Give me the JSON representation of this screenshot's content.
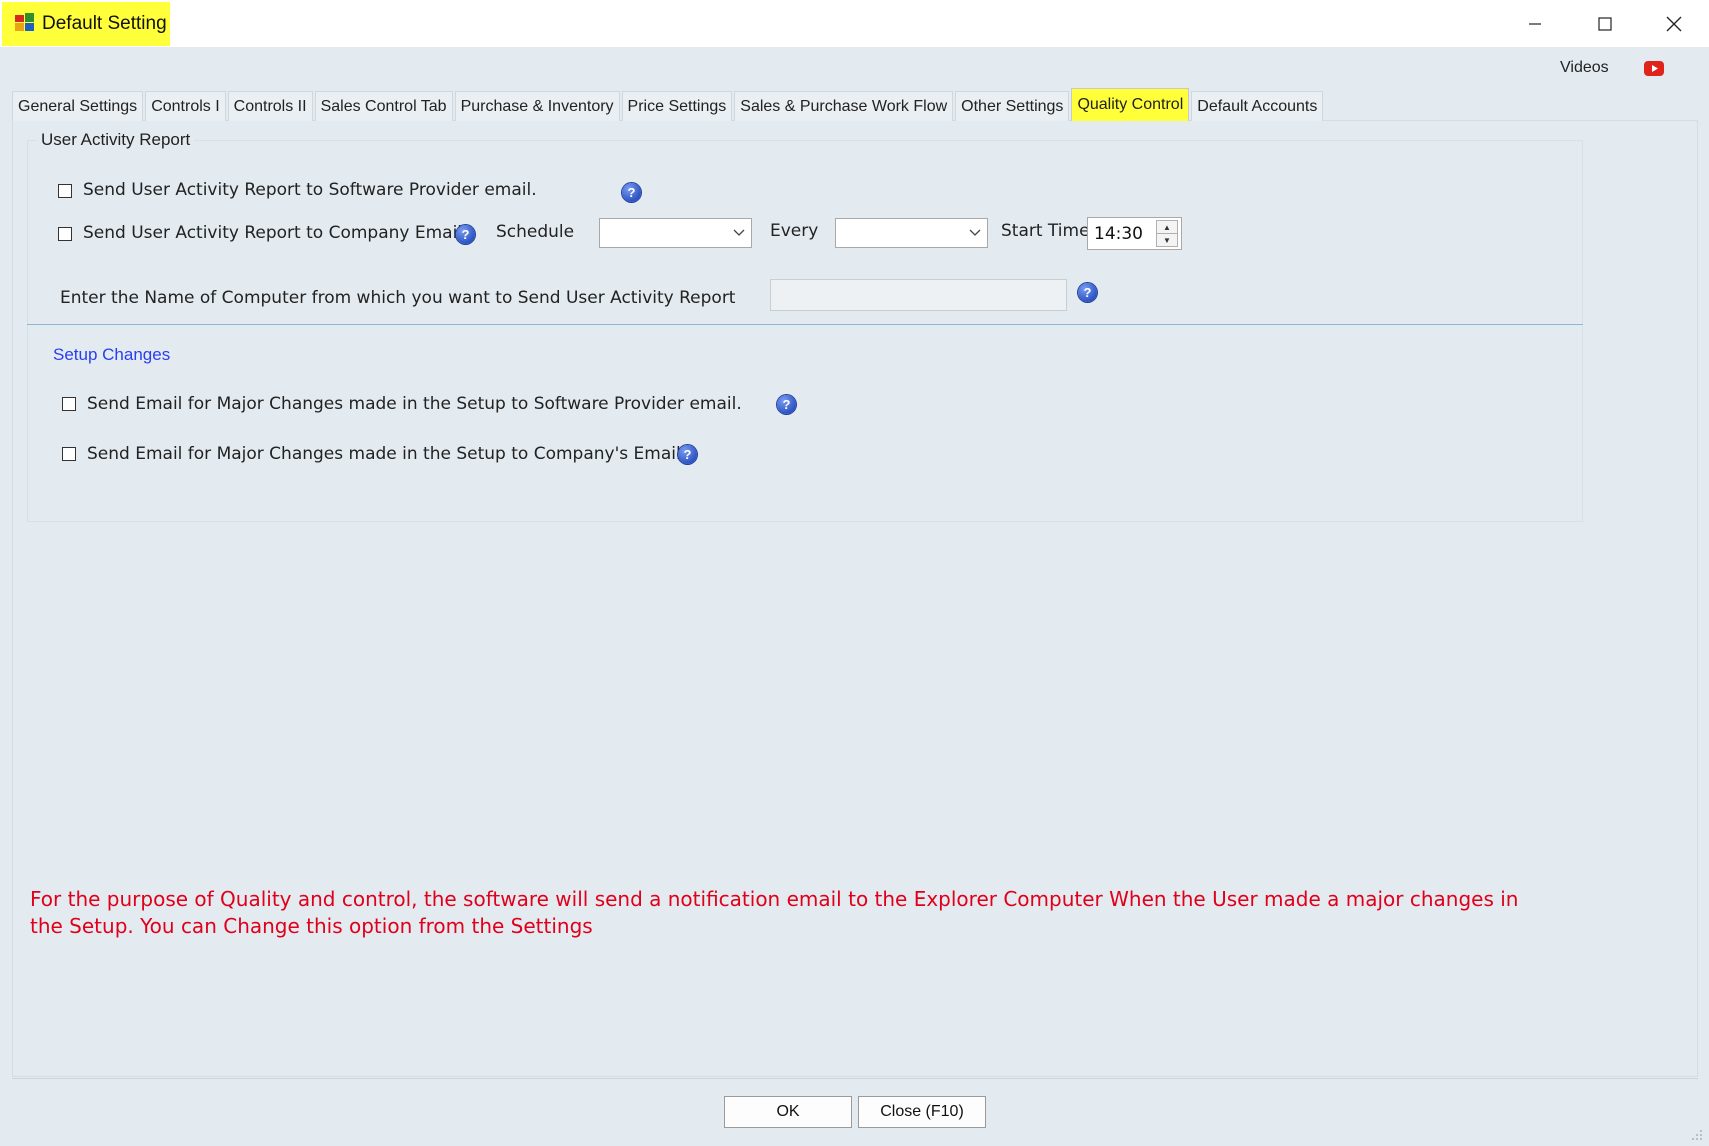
{
  "window": {
    "title": "Default Setting",
    "highlight_color": "#ffff3a"
  },
  "header": {
    "videos_label": "Videos"
  },
  "tabs": [
    {
      "label": "General Settings"
    },
    {
      "label": "Controls I"
    },
    {
      "label": "Controls II"
    },
    {
      "label": "Sales Control Tab"
    },
    {
      "label": "Purchase & Inventory"
    },
    {
      "label": "Price Settings"
    },
    {
      "label": "Sales & Purchase Work Flow"
    },
    {
      "label": "Other Settings"
    },
    {
      "label": "Quality Control"
    },
    {
      "label": "Default Accounts"
    }
  ],
  "active_tab": "Quality Control",
  "user_activity": {
    "group_title": "User Activity Report",
    "send_to_provider_label": "Send User Activity Report to Software Provider email.",
    "send_to_company_label": "Send User Activity Report to Company Email",
    "schedule_label": "Schedule",
    "schedule_value": "",
    "every_label": "Every",
    "every_value": "",
    "start_time_label": "Start Time",
    "start_time_value": "14:30",
    "computer_name_label": "Enter the Name of Computer from which you want to  Send User Activity Report",
    "computer_name_value": ""
  },
  "setup_changes": {
    "title": "Setup Changes",
    "provider_email_label": "Send Email for Major Changes made in the Setup to Software Provider email.",
    "company_email_label": "Send Email for Major Changes made in the Setup to Company's Email"
  },
  "notice": "For the purpose of Quality and control, the software will send a notification email to the Explorer Computer When the User made a major changes in the Setup. You can Change this option from the Settings",
  "footer": {
    "ok_label": "OK",
    "close_label": "Close (F10)"
  },
  "colors": {
    "background": "#e3ebf0",
    "notice_text": "#e0001b",
    "link_title": "#2a3ef0",
    "help_icon": "#2d54c4"
  }
}
